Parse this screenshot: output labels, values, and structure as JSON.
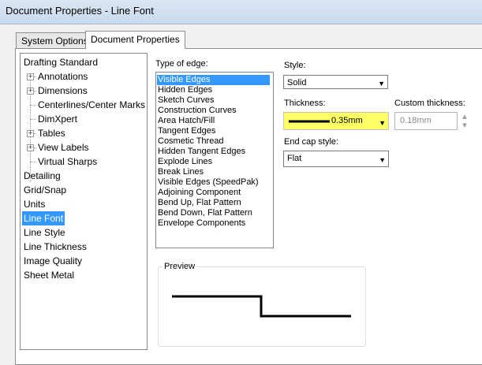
{
  "window": {
    "title": "Document Properties - Line Font"
  },
  "tabs": [
    {
      "label": "System Options"
    },
    {
      "label": "Document Properties"
    }
  ],
  "tree": {
    "items": [
      {
        "label": "Drafting Standard"
      },
      {
        "label": "Annotations"
      },
      {
        "label": "Dimensions"
      },
      {
        "label": "Centerlines/Center Marks"
      },
      {
        "label": "DimXpert"
      },
      {
        "label": "Tables"
      },
      {
        "label": "View Labels"
      },
      {
        "label": "Virtual Sharps"
      },
      {
        "label": "Detailing"
      },
      {
        "label": "Grid/Snap"
      },
      {
        "label": "Units"
      },
      {
        "label": "Line Font"
      },
      {
        "label": "Line Style"
      },
      {
        "label": "Line Thickness"
      },
      {
        "label": "Image Quality"
      },
      {
        "label": "Sheet Metal"
      }
    ],
    "selected": "Line Font"
  },
  "edges": {
    "label": "Type of edge:",
    "items": [
      "Visible Edges",
      "Hidden Edges",
      "Sketch Curves",
      "Construction Curves",
      "Area Hatch/Fill",
      "Tangent Edges",
      "Cosmetic Thread",
      "Hidden Tangent Edges",
      "Explode Lines",
      "Break Lines",
      "Visible Edges (SpeedPak)",
      "Adjoining Component",
      "Bend Up, Flat Pattern",
      "Bend Down, Flat Pattern",
      "Envelope Components"
    ],
    "selected": "Visible Edges"
  },
  "style": {
    "label": "Style:",
    "value": "Solid"
  },
  "thickness": {
    "label": "Thickness:",
    "value": "0.35mm",
    "highlight_color": "#ffff66"
  },
  "custom_thickness": {
    "label": "Custom thickness:",
    "value": "0.18mm"
  },
  "end_cap": {
    "label": "End cap style:",
    "value": "Flat"
  },
  "preview": {
    "label": "Preview"
  },
  "icons": {
    "dropdown": "chevron-down-icon",
    "spin_up": "spin-up-icon",
    "spin_down": "spin-down-icon",
    "expand": "plus-expander-icon"
  }
}
